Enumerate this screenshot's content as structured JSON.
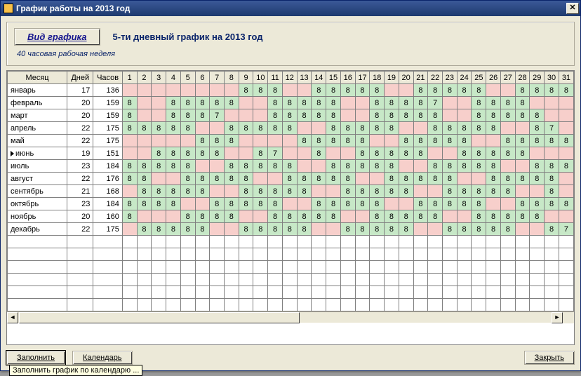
{
  "window": {
    "title": "График работы на 2013 год"
  },
  "toolbar": {
    "view_type_label": "Вид графика",
    "schedule_title": "5-ти дневный график на 2013 год",
    "subtitle": "40 часовая рабочая неделя"
  },
  "buttons": {
    "fill": "Заполнить",
    "calendar": "Календарь",
    "close": "Закрыть",
    "fill_tooltip": "Заполнить график по календарю ..."
  },
  "headers": {
    "month": "Месяц",
    "days": "Дней",
    "hours": "Часов"
  },
  "day_numbers": [
    1,
    2,
    3,
    4,
    5,
    6,
    7,
    8,
    9,
    10,
    11,
    12,
    13,
    14,
    15,
    16,
    17,
    18,
    19,
    20,
    21,
    22,
    23,
    24,
    25,
    26,
    27,
    28,
    29,
    30,
    31
  ],
  "current_row": 5,
  "months": [
    {
      "name": "январь",
      "days": 17,
      "hours": 136,
      "cells": [
        "",
        "",
        "",
        "",
        "",
        "",
        "",
        "",
        "8",
        "8",
        "8",
        "",
        "",
        "8",
        "8",
        "8",
        "8",
        "8",
        "",
        "",
        "8",
        "8",
        "8",
        "8",
        "8",
        "",
        "",
        "8",
        "8",
        "8",
        "8"
      ]
    },
    {
      "name": "февраль",
      "days": 20,
      "hours": 159,
      "cells": [
        "8",
        "",
        "",
        "8",
        "8",
        "8",
        "8",
        "8",
        "",
        "",
        "8",
        "8",
        "8",
        "8",
        "8",
        "",
        "",
        "8",
        "8",
        "8",
        "8",
        "7",
        "",
        "",
        "8",
        "8",
        "8",
        "8",
        "",
        "",
        ""
      ]
    },
    {
      "name": "март",
      "days": 20,
      "hours": 159,
      "cells": [
        "8",
        "",
        "",
        "8",
        "8",
        "8",
        "7",
        "",
        "",
        "",
        "8",
        "8",
        "8",
        "8",
        "8",
        "",
        "",
        "8",
        "8",
        "8",
        "8",
        "8",
        "",
        "",
        "8",
        "8",
        "8",
        "8",
        "8",
        "",
        ""
      ]
    },
    {
      "name": "апрель",
      "days": 22,
      "hours": 175,
      "cells": [
        "8",
        "8",
        "8",
        "8",
        "8",
        "",
        "",
        "8",
        "8",
        "8",
        "8",
        "8",
        "",
        "",
        "8",
        "8",
        "8",
        "8",
        "8",
        "",
        "",
        "8",
        "8",
        "8",
        "8",
        "8",
        "",
        "",
        "8",
        "7",
        ""
      ]
    },
    {
      "name": "май",
      "days": 22,
      "hours": 175,
      "cells": [
        "",
        "",
        "",
        "",
        "",
        "8",
        "8",
        "8",
        "",
        "",
        "",
        "",
        "8",
        "8",
        "8",
        "8",
        "8",
        "",
        "",
        "8",
        "8",
        "8",
        "8",
        "8",
        "",
        "",
        "8",
        "8",
        "8",
        "8",
        "8"
      ]
    },
    {
      "name": "июнь",
      "days": 19,
      "hours": 151,
      "cells": [
        "",
        "",
        "8",
        "8",
        "8",
        "8",
        "8",
        "",
        "",
        "8",
        "7",
        "",
        "",
        "8",
        "",
        "",
        "8",
        "8",
        "8",
        "8",
        "8",
        "",
        "",
        "8",
        "8",
        "8",
        "8",
        "8",
        "",
        "",
        ""
      ]
    },
    {
      "name": "июль",
      "days": 23,
      "hours": 184,
      "cells": [
        "8",
        "8",
        "8",
        "8",
        "8",
        "",
        "",
        "8",
        "8",
        "8",
        "8",
        "8",
        "",
        "",
        "8",
        "8",
        "8",
        "8",
        "8",
        "",
        "",
        "8",
        "8",
        "8",
        "8",
        "8",
        "",
        "",
        "8",
        "8",
        "8"
      ]
    },
    {
      "name": "август",
      "days": 22,
      "hours": 176,
      "cells": [
        "8",
        "8",
        "",
        "",
        "8",
        "8",
        "8",
        "8",
        "8",
        "",
        "",
        "8",
        "8",
        "8",
        "8",
        "8",
        "",
        "",
        "8",
        "8",
        "8",
        "8",
        "8",
        "",
        "",
        "8",
        "8",
        "8",
        "8",
        "8",
        ""
      ]
    },
    {
      "name": "сентябрь",
      "days": 21,
      "hours": 168,
      "cells": [
        "",
        "8",
        "8",
        "8",
        "8",
        "8",
        "",
        "",
        "8",
        "8",
        "8",
        "8",
        "8",
        "",
        "",
        "8",
        "8",
        "8",
        "8",
        "8",
        "",
        "",
        "8",
        "8",
        "8",
        "8",
        "8",
        "",
        "",
        "8",
        ""
      ]
    },
    {
      "name": "октябрь",
      "days": 23,
      "hours": 184,
      "cells": [
        "8",
        "8",
        "8",
        "8",
        "",
        "",
        "8",
        "8",
        "8",
        "8",
        "8",
        "",
        "",
        "8",
        "8",
        "8",
        "8",
        "8",
        "",
        "",
        "8",
        "8",
        "8",
        "8",
        "8",
        "",
        "",
        "8",
        "8",
        "8",
        "8"
      ]
    },
    {
      "name": "ноябрь",
      "days": 20,
      "hours": 160,
      "cells": [
        "8",
        "",
        "",
        "",
        "8",
        "8",
        "8",
        "8",
        "",
        "",
        "8",
        "8",
        "8",
        "8",
        "8",
        "",
        "",
        "8",
        "8",
        "8",
        "8",
        "8",
        "",
        "",
        "8",
        "8",
        "8",
        "8",
        "8",
        "",
        ""
      ]
    },
    {
      "name": "декабрь",
      "days": 22,
      "hours": 175,
      "cells": [
        "",
        "8",
        "8",
        "8",
        "8",
        "8",
        "",
        "",
        "8",
        "8",
        "8",
        "8",
        "8",
        "",
        "",
        "8",
        "8",
        "8",
        "8",
        "8",
        "",
        "",
        "8",
        "8",
        "8",
        "8",
        "8",
        "",
        "",
        "8",
        "7"
      ]
    }
  ]
}
